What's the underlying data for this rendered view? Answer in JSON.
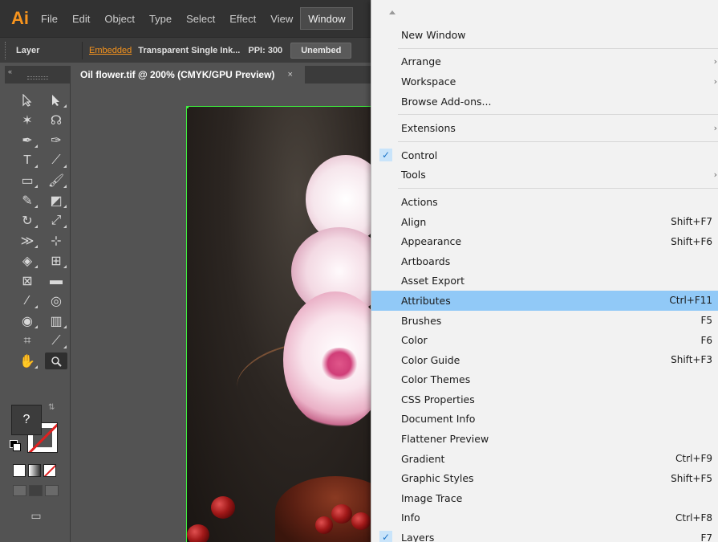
{
  "app": {
    "logo": "Ai"
  },
  "menubar": {
    "items": [
      "File",
      "Edit",
      "Object",
      "Type",
      "Select",
      "Effect",
      "View",
      "Window"
    ]
  },
  "controlbar": {
    "layer_label": "Layer",
    "embedded_link": "Embedded",
    "image_info": "Transparent Single Ink...",
    "ppi": "PPI: 300",
    "unembed_button": "Unembed"
  },
  "tools": {
    "collapse_label": "«",
    "fill_label": "?"
  },
  "document": {
    "tab_title": "Oil flower.tif @ 200% (CMYK/GPU Preview)",
    "close_label": "×"
  },
  "window_menu": {
    "items": [
      {
        "label": "New Window",
        "shortcut": "",
        "submenu": false,
        "checked": false,
        "highlighted": false
      },
      {
        "separator": true
      },
      {
        "label": "Arrange",
        "shortcut": "",
        "submenu": true,
        "checked": false,
        "highlighted": false
      },
      {
        "label": "Workspace",
        "shortcut": "",
        "submenu": true,
        "checked": false,
        "highlighted": false
      },
      {
        "label": "Browse Add-ons...",
        "shortcut": "",
        "submenu": false,
        "checked": false,
        "highlighted": false
      },
      {
        "separator": true
      },
      {
        "label": "Extensions",
        "shortcut": "",
        "submenu": true,
        "checked": false,
        "highlighted": false
      },
      {
        "separator": true
      },
      {
        "label": "Control",
        "shortcut": "",
        "submenu": false,
        "checked": true,
        "highlighted": false
      },
      {
        "label": "Tools",
        "shortcut": "",
        "submenu": true,
        "checked": false,
        "highlighted": false
      },
      {
        "separator": true
      },
      {
        "label": "Actions",
        "shortcut": "",
        "submenu": false,
        "checked": false,
        "highlighted": false
      },
      {
        "label": "Align",
        "shortcut": "Shift+F7",
        "submenu": false,
        "checked": false,
        "highlighted": false
      },
      {
        "label": "Appearance",
        "shortcut": "Shift+F6",
        "submenu": false,
        "checked": false,
        "highlighted": false
      },
      {
        "label": "Artboards",
        "shortcut": "",
        "submenu": false,
        "checked": false,
        "highlighted": false
      },
      {
        "label": "Asset Export",
        "shortcut": "",
        "submenu": false,
        "checked": false,
        "highlighted": false
      },
      {
        "label": "Attributes",
        "shortcut": "Ctrl+F11",
        "submenu": false,
        "checked": false,
        "highlighted": true
      },
      {
        "label": "Brushes",
        "shortcut": "F5",
        "submenu": false,
        "checked": false,
        "highlighted": false
      },
      {
        "label": "Color",
        "shortcut": "F6",
        "submenu": false,
        "checked": false,
        "highlighted": false
      },
      {
        "label": "Color Guide",
        "shortcut": "Shift+F3",
        "submenu": false,
        "checked": false,
        "highlighted": false
      },
      {
        "label": "Color Themes",
        "shortcut": "",
        "submenu": false,
        "checked": false,
        "highlighted": false
      },
      {
        "label": "CSS Properties",
        "shortcut": "",
        "submenu": false,
        "checked": false,
        "highlighted": false
      },
      {
        "label": "Document Info",
        "shortcut": "",
        "submenu": false,
        "checked": false,
        "highlighted": false
      },
      {
        "label": "Flattener Preview",
        "shortcut": "",
        "submenu": false,
        "checked": false,
        "highlighted": false
      },
      {
        "label": "Gradient",
        "shortcut": "Ctrl+F9",
        "submenu": false,
        "checked": false,
        "highlighted": false
      },
      {
        "label": "Graphic Styles",
        "shortcut": "Shift+F5",
        "submenu": false,
        "checked": false,
        "highlighted": false
      },
      {
        "label": "Image Trace",
        "shortcut": "",
        "submenu": false,
        "checked": false,
        "highlighted": false
      },
      {
        "label": "Info",
        "shortcut": "Ctrl+F8",
        "submenu": false,
        "checked": false,
        "highlighted": false
      },
      {
        "label": "Layers",
        "shortcut": "F7",
        "submenu": false,
        "checked": true,
        "highlighted": false
      }
    ],
    "check_glyph": "✓",
    "submenu_glyph": "›"
  },
  "colors": {
    "accent_orange": "#f7941d",
    "highlight_blue": "#91c9f7",
    "artboard_border": "#3ef03e"
  }
}
